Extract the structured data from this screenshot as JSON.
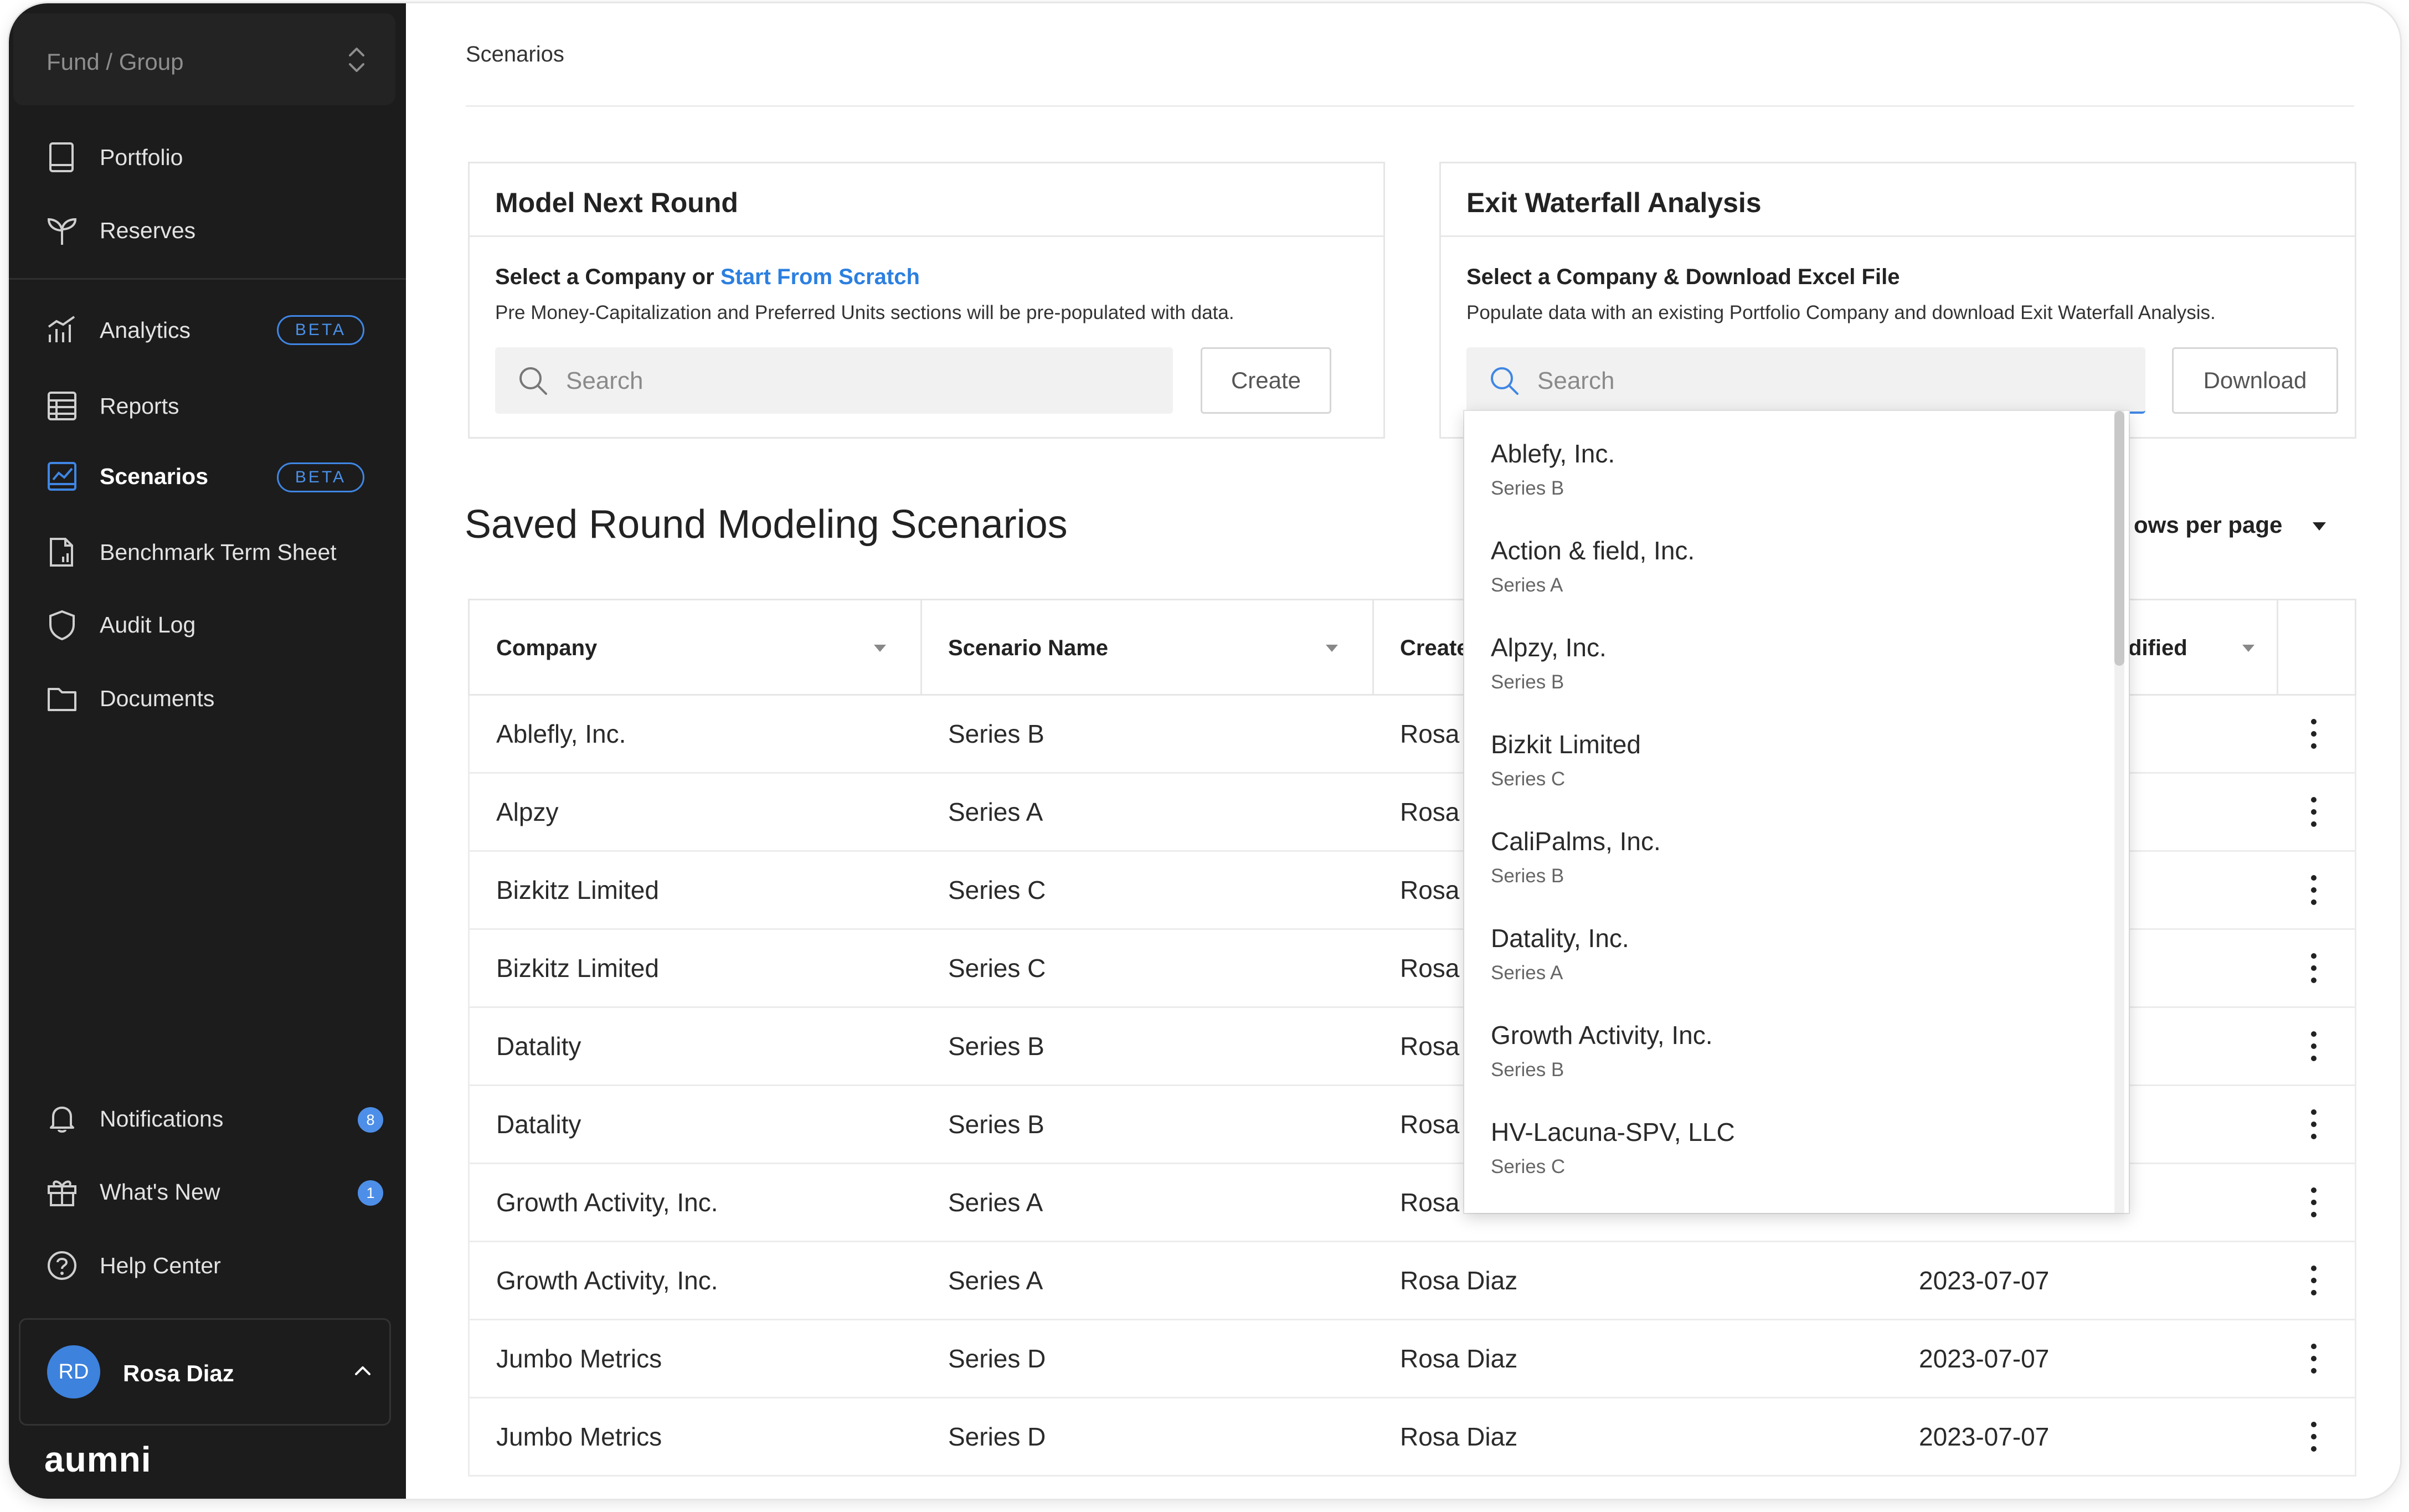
{
  "sidebar": {
    "fund_selector": "Fund / Group",
    "items": [
      {
        "label": "Portfolio"
      },
      {
        "label": "Reserves"
      },
      {
        "label": "Analytics",
        "badge": "BETA"
      },
      {
        "label": "Reports"
      },
      {
        "label": "Scenarios",
        "badge": "BETA",
        "active": true
      },
      {
        "label": "Benchmark Term Sheet"
      },
      {
        "label": "Audit Log"
      },
      {
        "label": "Documents"
      }
    ],
    "bottom_items": [
      {
        "label": "Notifications",
        "count": "8"
      },
      {
        "label": "What's New",
        "count": "1"
      },
      {
        "label": "Help Center"
      }
    ],
    "user": {
      "initials": "RD",
      "name": "Rosa Diaz"
    },
    "brand": "aumni",
    "icons": [
      "book-icon",
      "sprout-icon",
      "bar-chart-icon",
      "table-icon",
      "line-chart-icon",
      "document-chart-icon",
      "shield-icon",
      "folder-icon",
      "bell-icon",
      "gift-icon",
      "help-circle-icon",
      "chevron-up-icon"
    ]
  },
  "breadcrumb": "Scenarios",
  "model_next_round": {
    "title": "Model Next Round",
    "subtitle": "Select a Company or",
    "link": "Start From Scratch",
    "description": "Pre Money-Capitalization and Preferred Units sections will be pre-populated with data.",
    "search_placeholder": "Search",
    "button": "Create"
  },
  "exit_waterfall": {
    "title": "Exit Waterfall Analysis",
    "subtitle": "Select a Company & Download Excel File",
    "description": "Populate data with an existing Portfolio Company and download Exit Waterfall Analysis.",
    "search_placeholder": "Search",
    "button": "Download"
  },
  "saved_scenarios": {
    "title": "Saved Round Modeling Scenarios",
    "rows_per_page_label": "ows per page",
    "columns": [
      "Company",
      "Scenario Name",
      "Create",
      "dified"
    ],
    "rows": [
      {
        "company": "Ablefly, Inc.",
        "scenario": "Series B",
        "created_by": "Rosa I",
        "modified": ""
      },
      {
        "company": "Alpzy",
        "scenario": "Series A",
        "created_by": "Rosa I",
        "modified": ""
      },
      {
        "company": "Bizkitz Limited",
        "scenario": "Series C",
        "created_by": "Rosa I",
        "modified": ""
      },
      {
        "company": "Bizkitz Limited",
        "scenario": "Series C",
        "created_by": "Rosa I",
        "modified": ""
      },
      {
        "company": "Datality",
        "scenario": "Series B",
        "created_by": "Rosa I",
        "modified": ""
      },
      {
        "company": "Datality",
        "scenario": "Series B",
        "created_by": "Rosa I",
        "modified": ""
      },
      {
        "company": "Growth Activity, Inc.",
        "scenario": "Series A",
        "created_by": "Rosa I",
        "modified": ""
      },
      {
        "company": "Growth Activity, Inc.",
        "scenario": "Series A",
        "created_by": "Rosa Diaz",
        "modified": "2023-07-07"
      },
      {
        "company": "Jumbo Metrics",
        "scenario": "Series D",
        "created_by": "Rosa Diaz",
        "modified": "2023-07-07"
      },
      {
        "company": "Jumbo Metrics",
        "scenario": "Series D",
        "created_by": "Rosa Diaz",
        "modified": "2023-07-07"
      }
    ]
  },
  "company_dropdown": [
    {
      "name": "Ablefy, Inc.",
      "series": "Series B"
    },
    {
      "name": "Action & field, Inc.",
      "series": "Series A"
    },
    {
      "name": "Alpzy, Inc.",
      "series": "Series B"
    },
    {
      "name": "Bizkit Limited",
      "series": "Series C"
    },
    {
      "name": "CaliPalms, Inc.",
      "series": "Series B"
    },
    {
      "name": "Datality, Inc.",
      "series": "Series A"
    },
    {
      "name": "Growth Activity, Inc.",
      "series": "Series B"
    },
    {
      "name": "HV-Lacuna-SPV, LLC",
      "series": "Series C"
    }
  ],
  "colors": {
    "accent": "#3f86e4",
    "sidebar_bg": "#1c1c1c",
    "link": "#2b7fe0"
  }
}
